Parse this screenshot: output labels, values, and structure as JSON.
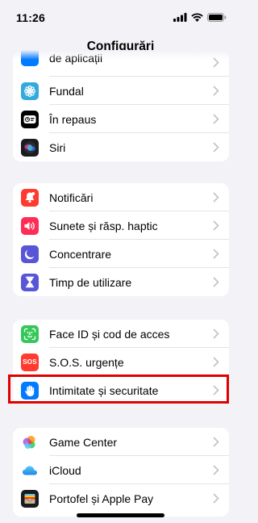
{
  "status_bar": {
    "time": "11:26",
    "icons": [
      "signal-icon",
      "wifi-icon",
      "battery-icon"
    ]
  },
  "nav": {
    "title": "Configurări"
  },
  "groups": [
    {
      "items": [
        {
          "label": "de aplicații",
          "icon": "app-library-icon",
          "color": "#007aff"
        },
        {
          "label": "Fundal",
          "icon": "flower-icon",
          "color": "#34aadc"
        },
        {
          "label": "În repaus",
          "icon": "standby-icon",
          "color": "#000000"
        },
        {
          "label": "Siri",
          "icon": "siri-icon",
          "color": "#1c1c1e"
        }
      ]
    },
    {
      "items": [
        {
          "label": "Notificări",
          "icon": "bell-icon",
          "color": "#ff3b30"
        },
        {
          "label": "Sunete și răsp. haptic",
          "icon": "speaker-icon",
          "color": "#ff2d55"
        },
        {
          "label": "Concentrare",
          "icon": "moon-icon",
          "color": "#5856d6"
        },
        {
          "label": "Timp de utilizare",
          "icon": "hourglass-icon",
          "color": "#5856d6"
        }
      ]
    },
    {
      "items": [
        {
          "label": "Face ID și cod de acces",
          "icon": "face-id-icon",
          "color": "#34c759"
        },
        {
          "label": "S.O.S. urgențe",
          "icon": "sos-icon",
          "icon_text": "SOS",
          "color": "#ff3b30"
        },
        {
          "label": "Intimitate și securitate",
          "icon": "hand-icon",
          "color": "#007aff"
        }
      ]
    },
    {
      "items": [
        {
          "label": "Game Center",
          "icon": "game-center-icon",
          "color": "#ffffff"
        },
        {
          "label": "iCloud",
          "icon": "cloud-icon",
          "color": "#ffffff"
        },
        {
          "label": "Portofel și Apple Pay",
          "icon": "wallet-icon",
          "color": "#1c1c1e"
        }
      ]
    }
  ],
  "highlight": {
    "color": "#e00000",
    "target": "Intimitate și securitate"
  }
}
